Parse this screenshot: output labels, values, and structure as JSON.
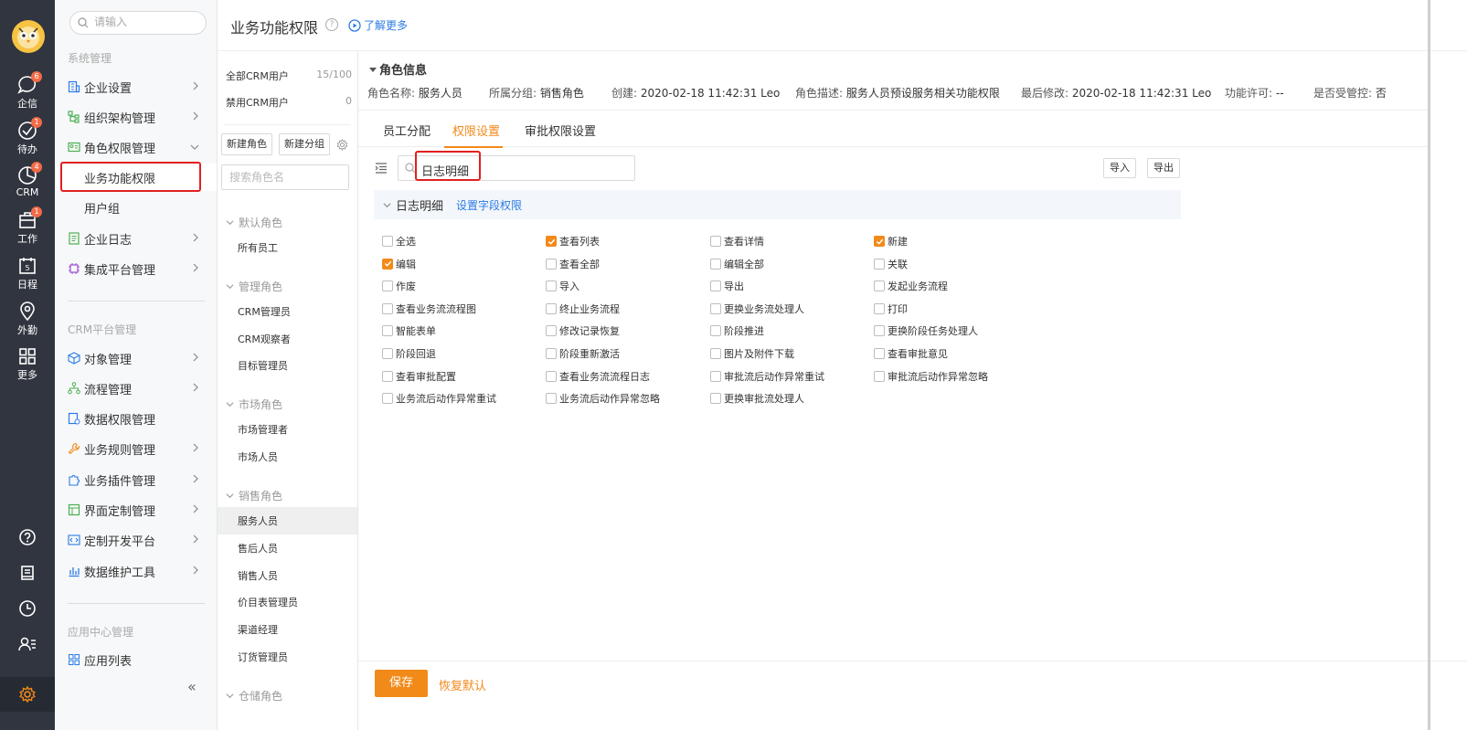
{
  "rail": {
    "items": [
      {
        "label": "企信",
        "badge": "6"
      },
      {
        "label": "待办",
        "badge": "1"
      },
      {
        "label": "CRM",
        "badge": "4"
      },
      {
        "label": "工作",
        "badge": "1"
      },
      {
        "label": "日程",
        "badge": ""
      },
      {
        "label": "外勤",
        "badge": ""
      },
      {
        "label": "更多",
        "badge": ""
      }
    ],
    "calendar_day": "5"
  },
  "nav": {
    "search_placeholder": "请输入",
    "section_system": "系统管理",
    "items_system": [
      "企业设置",
      "组织架构管理",
      "角色权限管理"
    ],
    "sub_items": [
      "业务功能权限",
      "用户组"
    ],
    "items_system2": [
      "企业日志",
      "集成平台管理"
    ],
    "section_crm": "CRM平台管理",
    "items_crm": [
      "对象管理",
      "流程管理",
      "数据权限管理",
      "业务规则管理",
      "业务插件管理",
      "界面定制管理",
      "定制开发平台",
      "数据维护工具"
    ],
    "section_app": "应用中心管理",
    "items_app": [
      "应用列表"
    ],
    "collapse": "«"
  },
  "header": {
    "title": "业务功能权限",
    "help": "?",
    "learn_more": "了解更多"
  },
  "roles": {
    "stats": [
      {
        "label": "全部CRM用户",
        "value": "15/100"
      },
      {
        "label": "禁用CRM用户",
        "value": "0"
      }
    ],
    "new_role": "新建角色",
    "new_group": "新建分组",
    "search_placeholder": "搜索角色名",
    "groups": [
      {
        "name": "默认角色",
        "roles": [
          "所有员工"
        ]
      },
      {
        "name": "管理角色",
        "roles": [
          "CRM管理员",
          "CRM观察者",
          "目标管理员"
        ]
      },
      {
        "name": "市场角色",
        "roles": [
          "市场管理者",
          "市场人员"
        ]
      },
      {
        "name": "销售角色",
        "roles": [
          "服务人员",
          "售后人员",
          "销售人员",
          "价目表管理员",
          "渠道经理",
          "订货管理员"
        ]
      },
      {
        "name": "仓储角色",
        "roles": []
      }
    ],
    "active_role": "服务人员"
  },
  "info": {
    "title": "角色信息",
    "fields": [
      {
        "key": "角色名称:",
        "value": "服务人员"
      },
      {
        "key": "所属分组:",
        "value": "销售角色"
      },
      {
        "key": "创建:",
        "value": "2020-02-18 11:42:31 Leo"
      },
      {
        "key": "角色描述:",
        "value": "服务人员预设服务相关功能权限"
      },
      {
        "key": "最后修改:",
        "value": "2020-02-18 11:42:31 Leo"
      },
      {
        "key": "功能许可:",
        "value": "--"
      },
      {
        "key": "是否受管控:",
        "value": "否"
      }
    ]
  },
  "tabs": [
    "员工分配",
    "权限设置",
    "审批权限设置"
  ],
  "active_tab": "权限设置",
  "perm_search_value": "日志明细",
  "import_label": "导入",
  "export_label": "导出",
  "module": {
    "title": "日志明细",
    "field_link": "设置字段权限"
  },
  "permissions": [
    {
      "label": "全选",
      "checked": false
    },
    {
      "label": "查看列表",
      "checked": true
    },
    {
      "label": "查看详情",
      "checked": false
    },
    {
      "label": "新建",
      "checked": true
    },
    {
      "label": "编辑",
      "checked": true
    },
    {
      "label": "查看全部",
      "checked": false
    },
    {
      "label": "编辑全部",
      "checked": false
    },
    {
      "label": "关联",
      "checked": false
    },
    {
      "label": "作废",
      "checked": false
    },
    {
      "label": "导入",
      "checked": false
    },
    {
      "label": "导出",
      "checked": false
    },
    {
      "label": "发起业务流程",
      "checked": false
    },
    {
      "label": "查看业务流流程图",
      "checked": false
    },
    {
      "label": "终止业务流程",
      "checked": false
    },
    {
      "label": "更换业务流处理人",
      "checked": false
    },
    {
      "label": "打印",
      "checked": false
    },
    {
      "label": "智能表单",
      "checked": false
    },
    {
      "label": "修改记录恢复",
      "checked": false
    },
    {
      "label": "阶段推进",
      "checked": false
    },
    {
      "label": "更换阶段任务处理人",
      "checked": false
    },
    {
      "label": "阶段回退",
      "checked": false
    },
    {
      "label": "阶段重新激活",
      "checked": false
    },
    {
      "label": "图片及附件下载",
      "checked": false
    },
    {
      "label": "查看审批意见",
      "checked": false
    },
    {
      "label": "查看审批配置",
      "checked": false
    },
    {
      "label": "查看业务流流程日志",
      "checked": false
    },
    {
      "label": "审批流后动作异常重试",
      "checked": false
    },
    {
      "label": "审批流后动作异常忽略",
      "checked": false
    },
    {
      "label": "业务流后动作异常重试",
      "checked": false
    },
    {
      "label": "业务流后动作异常忽略",
      "checked": false
    },
    {
      "label": "更换审批流处理人",
      "checked": false
    }
  ],
  "footer": {
    "save": "保存",
    "reset": "恢复默认"
  },
  "colors": {
    "accent": "#f28a1a",
    "link": "#2a7be4",
    "rail": "#31353f",
    "highlight": "#e02020"
  }
}
